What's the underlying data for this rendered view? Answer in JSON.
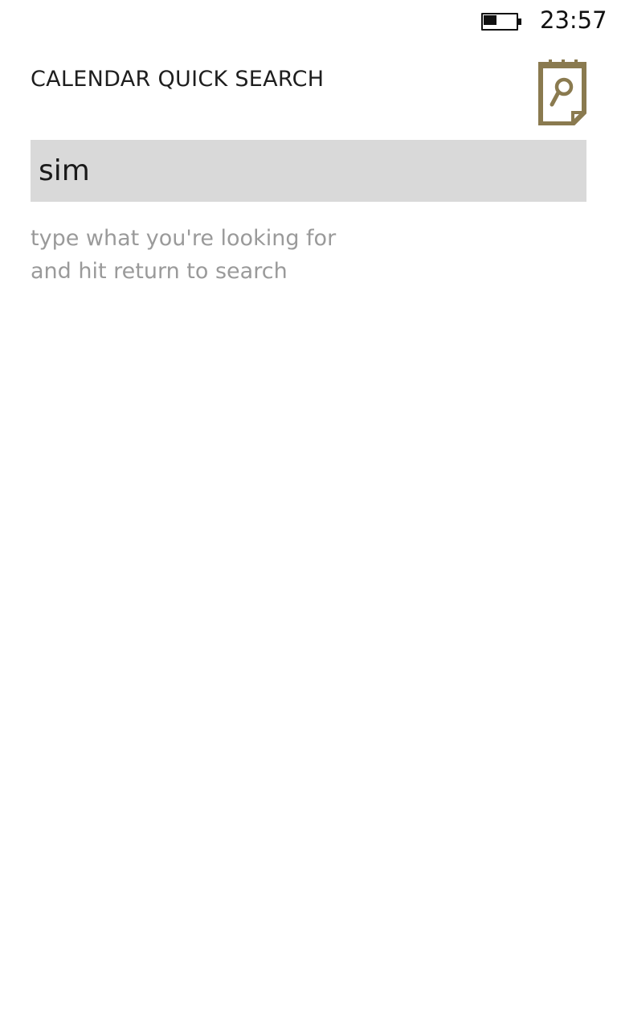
{
  "status_bar": {
    "time": "23:57",
    "battery_level": 0.45
  },
  "header": {
    "title": "CALENDAR QUICK SEARCH",
    "icon": "calendar-search-icon",
    "accent_color": "#8a7a4f"
  },
  "search": {
    "value": "sim",
    "background_color": "#d9d9d9"
  },
  "hint": {
    "line1": "type what you're looking for",
    "line2": "and hit return to search"
  }
}
